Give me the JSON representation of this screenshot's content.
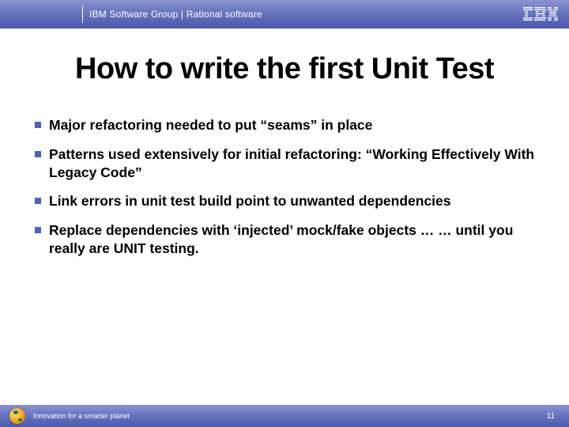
{
  "header": {
    "group": "IBM Software Group | Rational software",
    "logo_alt": "IBM"
  },
  "title": "How to write the first Unit Test",
  "bullets": [
    "Major refactoring needed to put “seams” in place",
    "Patterns used extensively for initial refactoring: “Working Effectively With Legacy Code”",
    "Link errors in unit test build point to unwanted dependencies",
    "Replace dependencies with ‘injected’ mock/fake objects … … until you really are UNIT testing."
  ],
  "footer": {
    "tagline": "Innovation for a smarter planet",
    "page": "11"
  }
}
